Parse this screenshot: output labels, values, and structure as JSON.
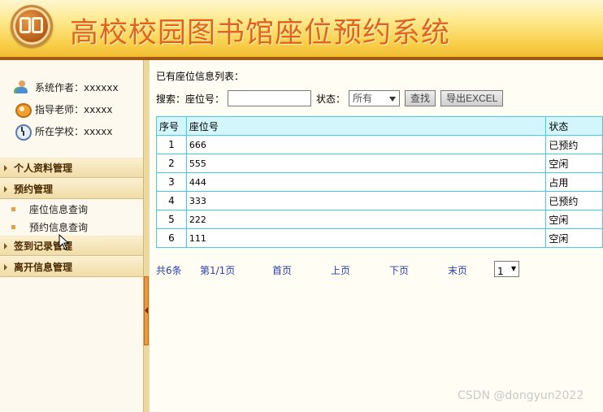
{
  "header": {
    "title": "高校校园图书馆座位预约系统"
  },
  "sidebar": {
    "info": [
      {
        "label": "系统作者：xxxxxx",
        "icon": "user-group-icon"
      },
      {
        "label": "指导老师：xxxxx",
        "icon": "teacher-icon"
      },
      {
        "label": "所在学校：xxxxx",
        "icon": "clock-icon"
      }
    ],
    "menu": [
      {
        "label": "个人资料管理"
      },
      {
        "label": "预约管理",
        "children": [
          "座位信息查询",
          "预约信息查询"
        ]
      },
      {
        "label": "签到记录管理"
      },
      {
        "label": "离开信息管理"
      }
    ]
  },
  "main": {
    "list_title": "已有座位信息列表：",
    "search": {
      "search_label": "搜索：",
      "seat_label": "座位号：",
      "seat_value": "",
      "status_label": "状态：",
      "status_selected": "所有",
      "find_button": "查找",
      "export_button": "导出EXCEL"
    },
    "table": {
      "headers": [
        "序号",
        "座位号",
        "状态"
      ],
      "rows": [
        [
          "1",
          "666",
          "已预约"
        ],
        [
          "2",
          "555",
          "空闲"
        ],
        [
          "3",
          "444",
          "占用"
        ],
        [
          "4",
          "333",
          "已预约"
        ],
        [
          "5",
          "222",
          "空闲"
        ],
        [
          "6",
          "111",
          "空闲"
        ]
      ]
    },
    "pager": {
      "total": "共6条",
      "page_info": "第1/1页",
      "first": "首页",
      "prev": "上页",
      "next": "下页",
      "last": "末页",
      "page_select": "1"
    }
  },
  "watermark": "CSDN @dongyun2022",
  "colors": {
    "title": "#e0651a",
    "table_border": "#3ed0e0",
    "table_header_bg": "#d2f6fb",
    "link": "#2a3fb0"
  }
}
